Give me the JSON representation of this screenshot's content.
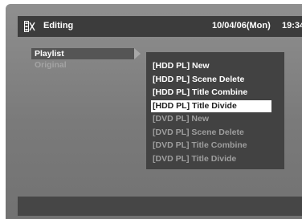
{
  "header": {
    "icon": "editing-icon",
    "title": "Editing",
    "date": "10/04/06(Mon)",
    "time": "19:34"
  },
  "left_menu": {
    "items": [
      {
        "label": "Playlist",
        "state": "active"
      },
      {
        "label": "Original",
        "state": "disabled"
      }
    ]
  },
  "submenu": {
    "items": [
      {
        "label": "[HDD PL] New",
        "enabled": true
      },
      {
        "label": "[HDD PL] Scene Delete",
        "enabled": true
      },
      {
        "label": "[HDD PL] Title Combine",
        "enabled": true
      },
      {
        "label": "[HDD PL] Title Divide",
        "enabled": true,
        "selected": true
      },
      {
        "label": "[DVD PL] New",
        "enabled": false
      },
      {
        "label": "[DVD PL] Scene Delete",
        "enabled": false
      },
      {
        "label": "[DVD PL] Title Combine",
        "enabled": false
      },
      {
        "label": "[DVD PL] Title Divide",
        "enabled": false
      }
    ]
  },
  "colors": {
    "background": "#7f7f7f",
    "header_bar": "#3c3c3c",
    "submenu_bg": "#424242",
    "selected_bg": "#ffffff",
    "disabled_text": "#9e9e9e"
  }
}
